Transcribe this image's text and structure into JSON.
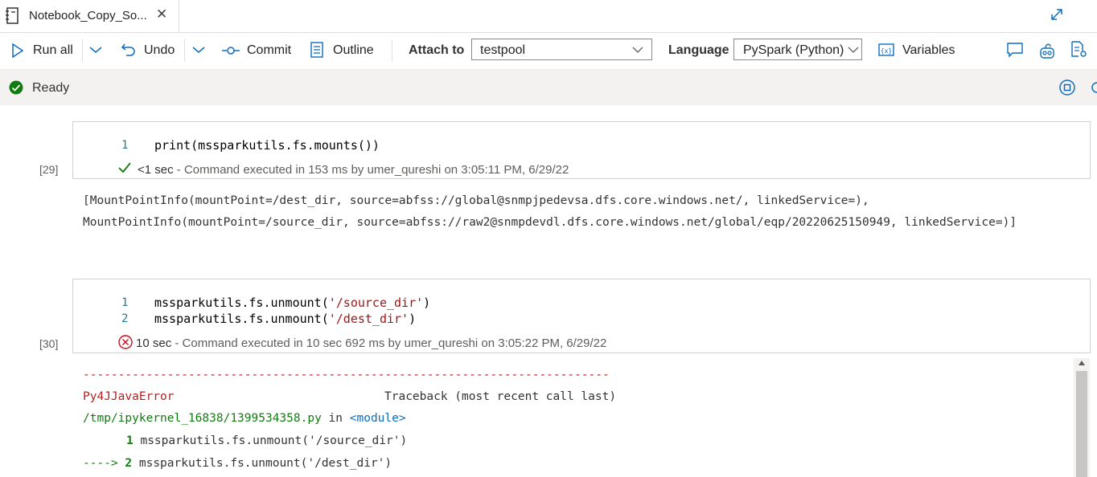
{
  "tab": {
    "title": "Notebook_Copy_So...",
    "close": "✕"
  },
  "toolbar": {
    "run_all": "Run all",
    "undo": "Undo",
    "commit": "Commit",
    "outline": "Outline",
    "attach_to_label": "Attach to",
    "attach_to_value": "testpool",
    "language_label": "Language",
    "language_value": "PySpark (Python)",
    "variables": "Variables"
  },
  "status": {
    "text": "Ready"
  },
  "cells": [
    {
      "exec_count": "[29]",
      "lines": [
        {
          "num": "1",
          "code": "print(mssparkutils.fs.mounts())"
        }
      ],
      "result_icon": "check-icon",
      "duration": "<1 sec",
      "message": "- Command executed in 153 ms by umer_qureshi on 3:05:11 PM, 6/29/22",
      "output": [
        "[MountPointInfo(mountPoint=/dest_dir, source=abfss://global@snmpjpedevsa.dfs.core.windows.net/, linkedService=),",
        "MountPointInfo(mountPoint=/source_dir, source=abfss://raw2@snmpdevdl.dfs.core.windows.net/global/eqp/20220625150949, linkedService=)]"
      ]
    },
    {
      "exec_count": "[30]",
      "lines": [
        {
          "num": "1",
          "code_prefix": "mssparkutils.fs.unmount(",
          "code_str": "'/source_dir'",
          "code_suffix": ")"
        },
        {
          "num": "2",
          "code_prefix": "mssparkutils.fs.unmount(",
          "code_str": "'/dest_dir'",
          "code_suffix": ")"
        }
      ],
      "result_icon": "error-icon",
      "duration": "10 sec",
      "message": "- Command executed in 10 sec 692 ms by umer_qureshi on 3:05:22 PM, 6/29/22",
      "output": {
        "dashes": "---------------------------------------------------------------------------",
        "error_name": "Py4JJavaError",
        "traceback": "Traceback (most recent call last)",
        "file": "/tmp/ipykernel_16838/1399534358.py",
        "in": "in",
        "module": "<module>",
        "tb_line1_num": "1",
        "tb_line1_code": "mssparkutils.fs.unmount('/source_dir')",
        "tb_arrow": "---->",
        "tb_line2_num": "2",
        "tb_line2_code": "mssparkutils.fs.unmount('/dest_dir')"
      }
    }
  ],
  "colors": {
    "accent": "#0f6cbd",
    "success": "#107c10",
    "error": "#c50f1f"
  }
}
